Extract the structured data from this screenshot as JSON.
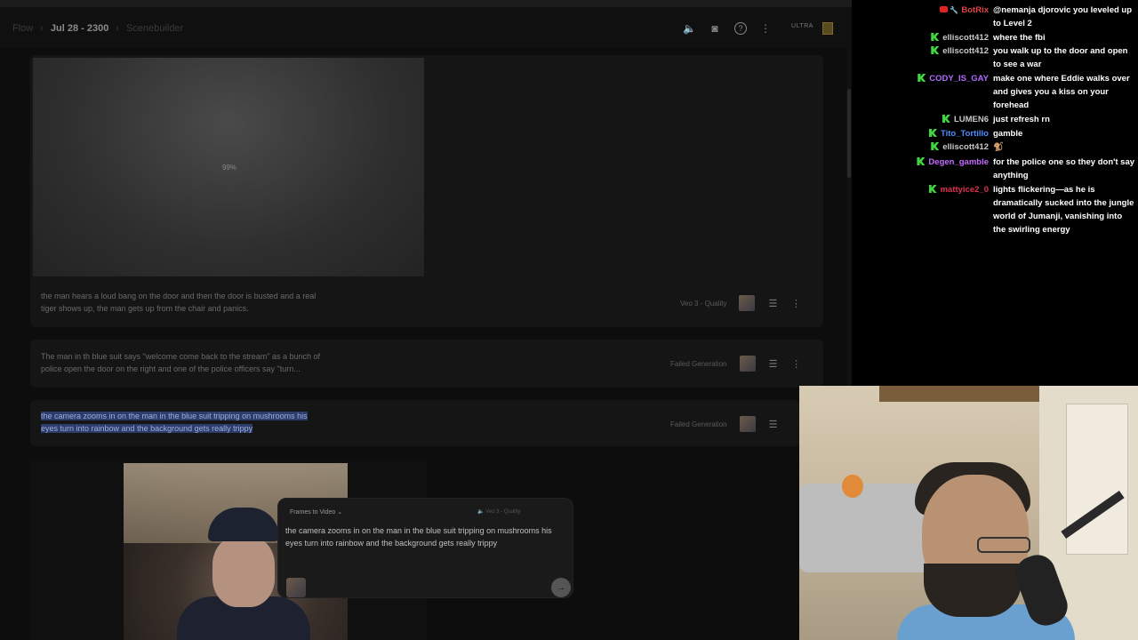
{
  "header": {
    "breadcrumb_root": "Flow",
    "breadcrumb_project": "Jul 28 - 2300",
    "breadcrumb_tab": "Scenebuilder",
    "ultra_badge": "ULTRA",
    "icons": [
      "speaker-icon",
      "discord-icon",
      "help-icon",
      "more-icon"
    ]
  },
  "cards": [
    {
      "progress": "99%",
      "prompt": "the man hears a loud bang on the door and then the door is busted and a real tiger shows up, the man gets up from the chair and panics.",
      "model": "Veo 3 - Quality"
    },
    {
      "prompt": "The man in th blue suit says \"welcome come back to the stream\" as a bunch of police open the door on the right and one of the police officers say \"turn...",
      "status": "Failed Generation"
    },
    {
      "prompt_line1": "the camera zooms in on the man in the blue suit tripping on mushrooms his",
      "prompt_line2": "eyes turn into rainbow and the background gets really trippy",
      "status": "Failed Generation"
    }
  ],
  "composer": {
    "mode": "Frames to Video",
    "model": "Veo 3 - Quality",
    "text": "the camera zooms in on the man in the blue suit tripping on mushrooms his eyes turn into rainbow and the background gets really trippy",
    "send_icon": "arrow-right-icon"
  },
  "chat": [
    {
      "user": "BotRix",
      "color": "#e04545",
      "badges": [
        "youtube",
        "wrench"
      ],
      "text": "@nemanja djorovic you leveled up to Level 2"
    },
    {
      "user": "elliscott412",
      "color": "#c8c8c8",
      "badges": [
        "kick"
      ],
      "text": "where the fbi"
    },
    {
      "user": "elliscott412",
      "color": "#c8c8c8",
      "badges": [
        "kick"
      ],
      "text": "you walk up to the door and open to see a war"
    },
    {
      "user": "CODY_IS_GAY",
      "color": "#b36bff",
      "badges": [
        "kick"
      ],
      "text": "make one where Eddie walks over and gives you a kiss on your forehead"
    },
    {
      "user": "LUMEN6",
      "color": "#c8c8c8",
      "badges": [
        "kick"
      ],
      "text": "just refresh rn"
    },
    {
      "user": "Tito_Tortillo",
      "color": "#4f8cff",
      "badges": [
        "kick"
      ],
      "text": "gamble"
    },
    {
      "user": "elliscott412",
      "color": "#c8c8c8",
      "badges": [
        "kick"
      ],
      "text": "🐒"
    },
    {
      "user": "Degen_gamble",
      "color": "#c46bff",
      "badges": [
        "kick"
      ],
      "text": "for the police one so they don't say anything"
    },
    {
      "user": "mattyice2_0",
      "color": "#e03050",
      "badges": [
        "kick"
      ],
      "text": "lights flickering—as he is dramatically sucked into the jungle world of Jumanji, vanishing into the swirling energy"
    }
  ]
}
